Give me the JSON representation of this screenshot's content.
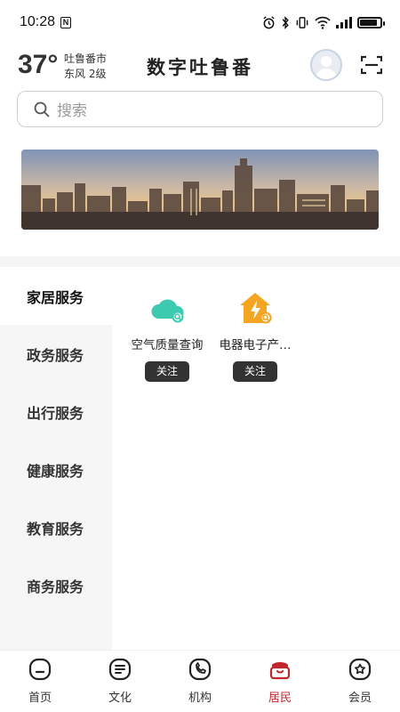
{
  "status_bar": {
    "time": "10:28",
    "n_badge": "N",
    "signal_label": "4G"
  },
  "header": {
    "temperature": "37°",
    "city": "吐鲁番市",
    "wind": "东风  2级",
    "title": "数字吐鲁番"
  },
  "search": {
    "placeholder": "搜索"
  },
  "categories": [
    {
      "label": "家居服务",
      "active": true
    },
    {
      "label": "政务服务",
      "active": false
    },
    {
      "label": "出行服务",
      "active": false
    },
    {
      "label": "健康服务",
      "active": false
    },
    {
      "label": "教育服务",
      "active": false
    },
    {
      "label": "商务服务",
      "active": false
    }
  ],
  "services": [
    {
      "name": "空气质量查询",
      "button": "关注",
      "icon": "cloud-search-icon",
      "color": "#3ccab0"
    },
    {
      "name": "电器电子产…",
      "button": "关注",
      "icon": "house-lightning-icon",
      "color": "#f4a521"
    }
  ],
  "nav": [
    {
      "label": "首页",
      "icon": "home-face-icon",
      "active": false
    },
    {
      "label": "文化",
      "icon": "document-lines-icon",
      "active": false
    },
    {
      "label": "机构",
      "icon": "phone-icon",
      "active": false
    },
    {
      "label": "居民",
      "icon": "resident-icon",
      "active": true
    },
    {
      "label": "会员",
      "icon": "star-badge-icon",
      "active": false
    }
  ],
  "colors": {
    "accent": "#c0262d",
    "button_dark": "#333333",
    "sidebar_bg": "#f6f6f6"
  }
}
